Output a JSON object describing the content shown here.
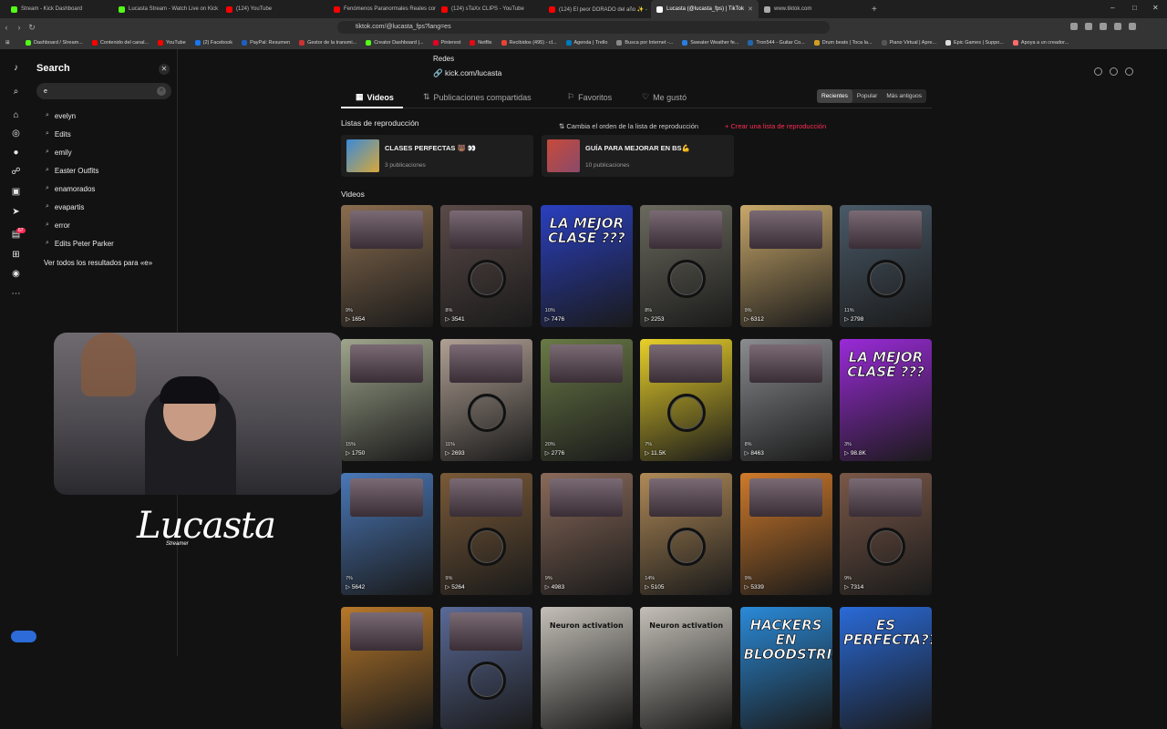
{
  "browser": {
    "tabs": [
      {
        "title": "Stream - Kick Dashboard",
        "color": "#53fc18"
      },
      {
        "title": "Lucasta Stream - Watch Live on Kick",
        "color": "#53fc18"
      },
      {
        "title": "(124) YouTube",
        "color": "#ff0000"
      },
      {
        "title": "Fenómenos Paranormales Reales con",
        "color": "#ff0000"
      },
      {
        "title": "(124) sTaXx CLIPS - YouTube",
        "color": "#ff0000"
      },
      {
        "title": "(124) El peor DORADO del año ✨ -",
        "color": "#ff0000"
      },
      {
        "title": "Lucasta (@lucasta_fps) | TikTok",
        "color": "#ffffff",
        "active": true
      },
      {
        "title": "www.tiktok.com",
        "color": "#aaaaaa"
      }
    ],
    "url": "tiktok.com/@lucasta_fps?lang=es",
    "bookmarks": [
      {
        "label": "Dashboard / Stream...",
        "color": "#53fc18"
      },
      {
        "label": "Contenido del canal...",
        "color": "#ff0000"
      },
      {
        "label": "YouTube",
        "color": "#ff0000"
      },
      {
        "label": "(2) Facebook",
        "color": "#1877f2"
      },
      {
        "label": "PayPal: Resumen",
        "color": "#1f5fbf"
      },
      {
        "label": "Gestor de la transmi...",
        "color": "#cc3333"
      },
      {
        "label": "Creator Dashboard |...",
        "color": "#53fc18"
      },
      {
        "label": "Pinterest",
        "color": "#e60023"
      },
      {
        "label": "Netflix",
        "color": "#e50914"
      },
      {
        "label": "Recibidos (495) - cl...",
        "color": "#ea4335"
      },
      {
        "label": "Agenda | Trello",
        "color": "#0079bf"
      },
      {
        "label": "Busca por Internet -...",
        "color": "#888888"
      },
      {
        "label": "Sweater Weather fe...",
        "color": "#2a7de1"
      },
      {
        "label": "Tron544 - Guitar Co...",
        "color": "#2266aa"
      },
      {
        "label": "Drum beats | Toca la...",
        "color": "#d0a020"
      },
      {
        "label": "Piano Virtual | Apre...",
        "color": "#555555"
      },
      {
        "label": "Epic Games | Suppo...",
        "color": "#dddddd"
      },
      {
        "label": "Apoya a un creador...",
        "color": "#ff6b6b"
      }
    ]
  },
  "search": {
    "title": "Search",
    "query": "e",
    "suggestions": [
      "evelyn",
      "Edits",
      "emily",
      "Easter Outfits",
      "enamorados",
      "evapartis",
      "error",
      "Edits Peter Parker"
    ],
    "see_all": "Ver todos los resultados para «e»"
  },
  "rail": {
    "notification_count": "67"
  },
  "overlay": {
    "logo": "Lucasta",
    "logo_sub": "Streamer"
  },
  "profile": {
    "redes": "Redes",
    "kick_link": "kick.com/lucasta",
    "tabs": [
      "Videos",
      "Publicaciones compartidas",
      "Favoritos",
      "Me gustó"
    ],
    "sort": [
      "Recientes",
      "Popular",
      "Más antiguos"
    ],
    "playlists_title": "Listas de reproducción",
    "reorder_label": "Cambia el orden de la lista de reproducción",
    "create_label": "Crear una lista de reproducción",
    "playlists": [
      {
        "name": "CLASES PERFECTAS 🐻 👀",
        "count": "3 publicaciones"
      },
      {
        "name": "GUÍA PARA MEJORAR EN BS💪",
        "count": "10 publicaciones"
      }
    ],
    "videos_title": "Videos",
    "videos": [
      {
        "views": "1654",
        "pct": "9%",
        "bg": "#8a6d4f",
        "text": ""
      },
      {
        "views": "3541",
        "pct": "8%",
        "bg": "#5a4a48",
        "text": ""
      },
      {
        "views": "7476",
        "pct": "10%",
        "bg": "#2a3fbf",
        "text": "LA MEJOR CLASE ???"
      },
      {
        "views": "2253",
        "pct": "8%",
        "bg": "#6b6a5e",
        "text": ""
      },
      {
        "views": "6312",
        "pct": "9%",
        "bg": "#c9a86a",
        "text": ""
      },
      {
        "views": "2798",
        "pct": "11%",
        "bg": "#4a5a68",
        "text": ""
      },
      {
        "views": "1750",
        "pct": "15%",
        "bg": "#9fa58c",
        "text": ""
      },
      {
        "views": "2693",
        "pct": "11%",
        "bg": "#b0a094",
        "text": ""
      },
      {
        "views": "2776",
        "pct": "20%",
        "bg": "#6a7a46",
        "text": ""
      },
      {
        "views": "11.5K",
        "pct": "7%",
        "bg": "#e8d02a",
        "text": ""
      },
      {
        "views": "8463",
        "pct": "8%",
        "bg": "#8a8c90",
        "text": ""
      },
      {
        "views": "98.8K",
        "pct": "3%",
        "bg": "#9a2ad8",
        "text": "LA MEJOR CLASE ???"
      },
      {
        "views": "5642",
        "pct": "7%",
        "bg": "#4a78b8",
        "text": ""
      },
      {
        "views": "5264",
        "pct": "9%",
        "bg": "#7a5a38",
        "text": ""
      },
      {
        "views": "4983",
        "pct": "9%",
        "bg": "#8a6a5a",
        "text": ""
      },
      {
        "views": "5105",
        "pct": "14%",
        "bg": "#b08a58",
        "text": ""
      },
      {
        "views": "5339",
        "pct": "9%",
        "bg": "#d07a2a",
        "text": ""
      },
      {
        "views": "7314",
        "pct": "9%",
        "bg": "#7a5848",
        "text": ""
      },
      {
        "views": "",
        "pct": "",
        "bg": "#b8782a",
        "text": ""
      },
      {
        "views": "",
        "pct": "",
        "bg": "#5a6a98",
        "text": ""
      },
      {
        "views": "",
        "pct": "",
        "bg": "#c4c0b8",
        "text": "Neuron activation"
      },
      {
        "views": "",
        "pct": "",
        "bg": "#c4c0b8",
        "text": "Neuron activation"
      },
      {
        "views": "",
        "pct": "",
        "bg": "#2a8ad8",
        "text": "HACKERS EN BLOODSTRIKE"
      },
      {
        "views": "",
        "pct": "",
        "bg": "#2a6ad8",
        "text": "ES PERFECTA???"
      }
    ]
  },
  "colors": {
    "accent": "#fe2c55",
    "background": "#121212",
    "panel": "#1e1e1e"
  }
}
